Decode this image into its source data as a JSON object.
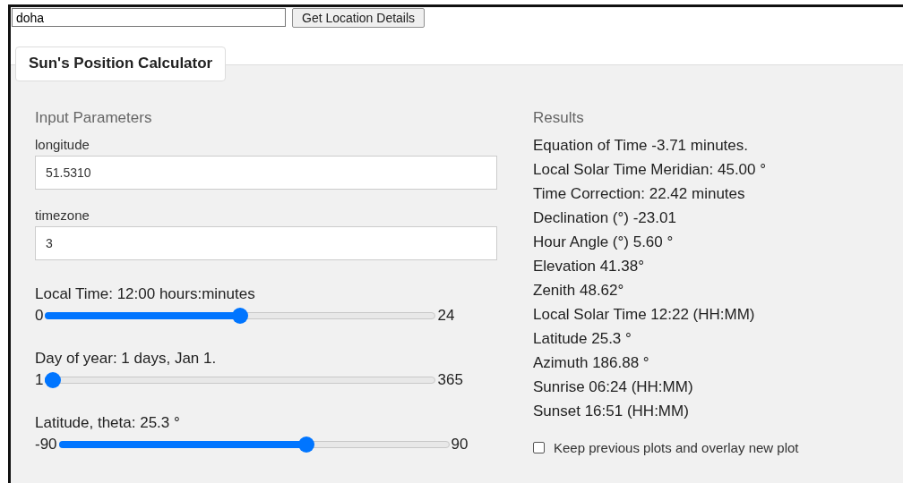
{
  "search": {
    "value": "doha"
  },
  "search_button": "Get Location Details",
  "tab": {
    "label": "Sun's Position Calculator",
    "selected": true
  },
  "inputs": {
    "title": "Input Parameters",
    "fields": [
      {
        "label": "longitude",
        "value": "51.5310"
      },
      {
        "label": "timezone",
        "value": "3"
      }
    ],
    "sliders": [
      {
        "label": "Local Time: 12:00 hours:minutes",
        "min": "0",
        "max": "24",
        "level": 0.5
      },
      {
        "label": "Day of year: 1 days, Jan 1.",
        "min": "1",
        "max": "365",
        "level": 0
      },
      {
        "label": "Latitude, theta: 25.3 °",
        "min": "-90",
        "max": "90",
        "level": 0.64
      }
    ]
  },
  "results": {
    "title": "Results",
    "lines": [
      "Equation of Time -3.71 minutes.",
      "Local Solar Time Meridian: 45.00 °",
      "Time Correction: 22.42 minutes",
      "Declination (°) -23.01",
      "Hour Angle (°) 5.60 °",
      "Elevation 41.38°",
      "Zenith 48.62°",
      "Local Solar Time 12:22 (HH:MM)",
      "Latitude 25.3 °",
      "Azimuth 186.88 °",
      "Sunrise 06:24 (HH:MM)",
      "Sunset 16:51 (HH:MM)"
    ]
  },
  "overlay_option": {
    "label": "Keep previous plots and overlay new plot",
    "checked": false
  }
}
